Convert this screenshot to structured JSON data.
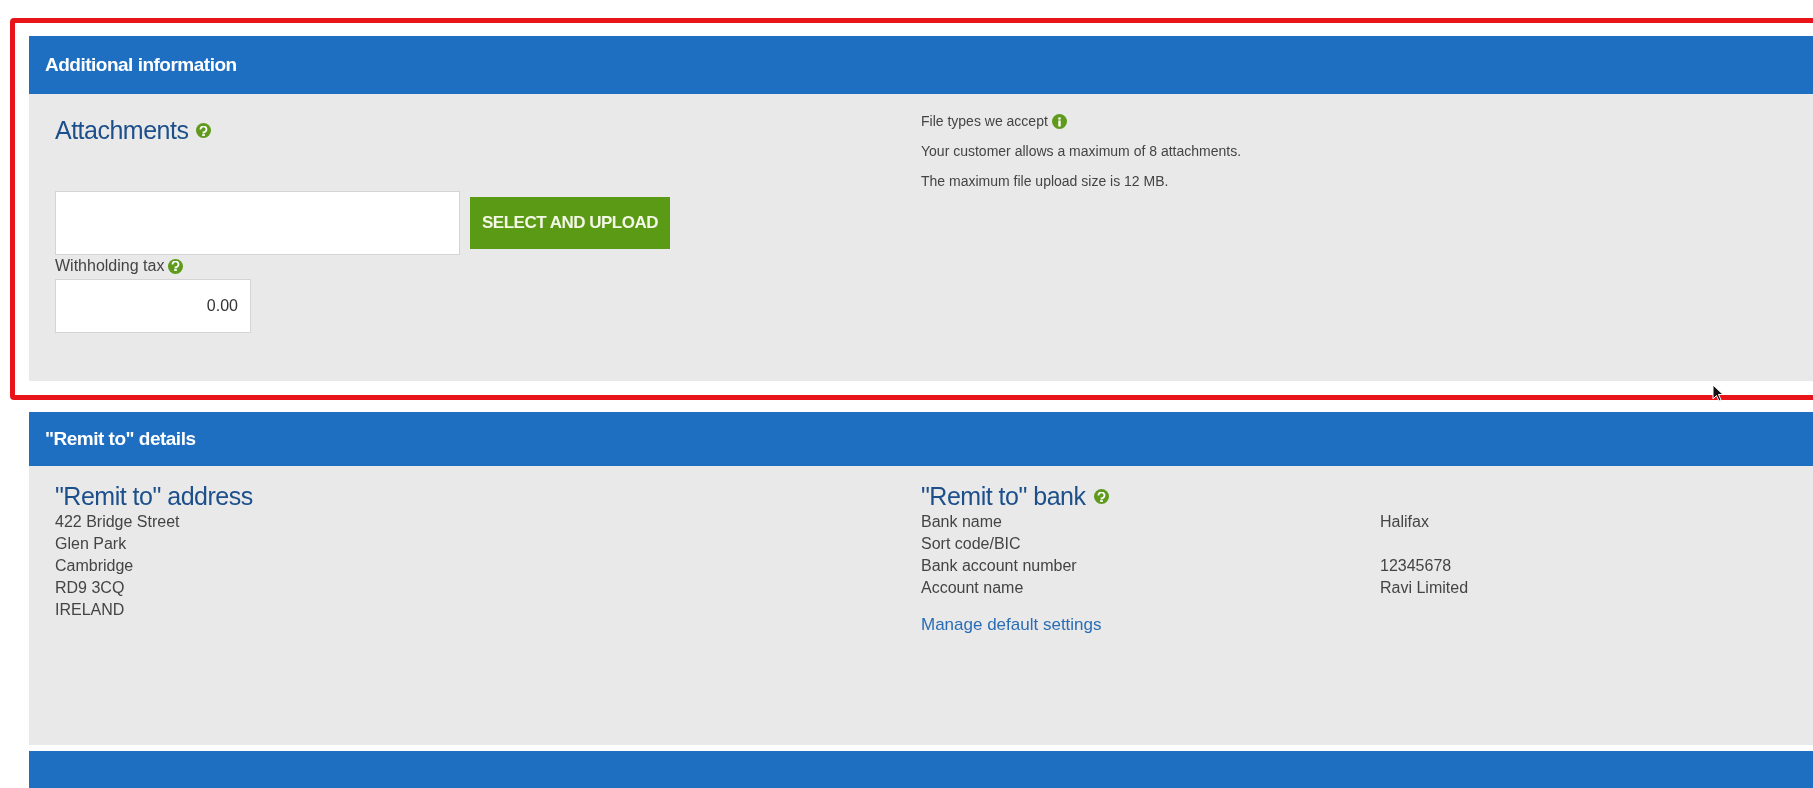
{
  "additional_information": {
    "title": "Additional information",
    "highlighted": true,
    "attachments": {
      "heading": "Attachments",
      "button": "SELECT AND UPLOAD"
    },
    "withholding_tax": {
      "label": "Withholding tax",
      "value": "0.00"
    },
    "file_types": "File types we accept",
    "notes": [
      "Your customer allows a maximum of 8 attachments.",
      "The maximum file upload size is 12 MB."
    ]
  },
  "remit_to": {
    "title": "\"Remit to\" details",
    "address": {
      "heading": "\"Remit to\" address",
      "lines": [
        "422 Bridge Street",
        "Glen Park",
        "Cambridge",
        "RD9 3CQ",
        "IRELAND"
      ]
    },
    "bank": {
      "heading": "\"Remit to\" bank",
      "rows": [
        {
          "label": "Bank name",
          "value": "Halifax"
        },
        {
          "label": "Sort code/BIC"
        },
        {
          "label": "Bank account number",
          "value": "12345678"
        },
        {
          "label": "Account name",
          "value": "Ravi Limited"
        }
      ],
      "link": "Manage default settings"
    }
  }
}
